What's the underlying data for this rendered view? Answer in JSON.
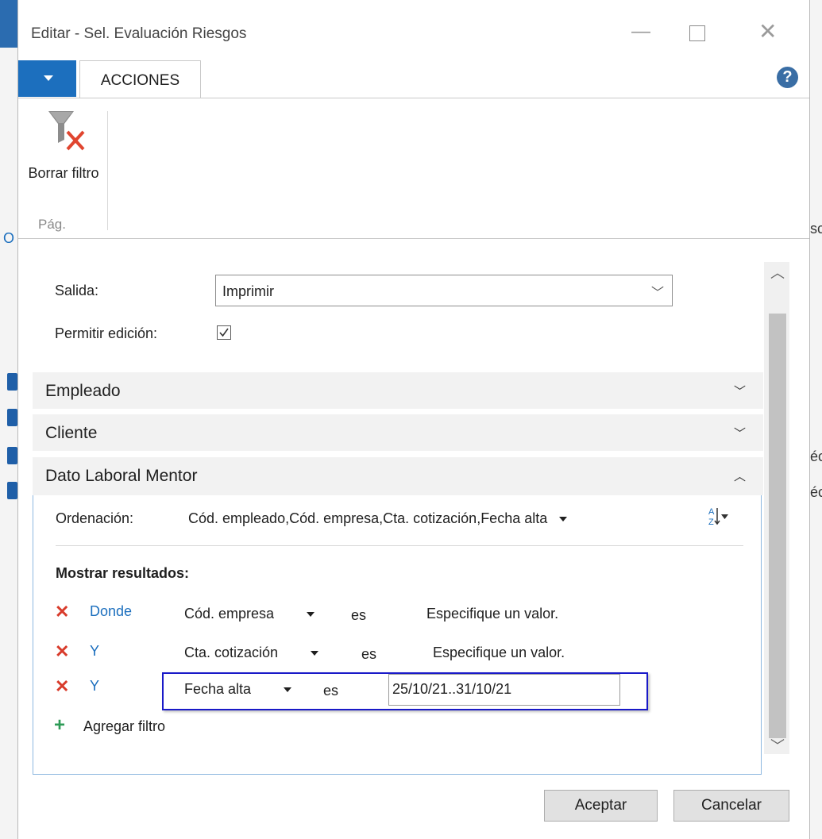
{
  "window": {
    "title": "Editar - Sel. Evaluación Riesgos",
    "minimize_icon": "minimize-icon",
    "maximize_icon": "maximize-icon",
    "close_icon": "close-icon"
  },
  "ribbon": {
    "tab_label": "ACCIONES",
    "help_label": "?",
    "clear_filter_label": "Borrar filtro",
    "group_label": "Pág."
  },
  "options": {
    "salida_label": "Salida:",
    "salida_value": "Imprimir",
    "permitir_label": "Permitir edición:",
    "permitir_checked": true
  },
  "fasttabs": {
    "empleado": "Empleado",
    "cliente": "Cliente",
    "dato": "Dato Laboral Mentor"
  },
  "dato": {
    "ordenacion_label": "Ordenación:",
    "ordenacion_value": "Cód. empleado,Cód. empresa,Cta. cotización,Fecha alta",
    "mostrar_label": "Mostrar resultados:",
    "filters": [
      {
        "connector": "Donde",
        "field": "Cód. empresa",
        "operator": "es",
        "value": "Especifique un valor."
      },
      {
        "connector": "Y",
        "field": "Cta. cotización",
        "operator": "es",
        "value": "Especifique un valor."
      },
      {
        "connector": "Y",
        "field": "Fecha alta",
        "operator": "es",
        "value": "25/10/21..31/10/21"
      }
    ],
    "add_filter_label": "Agregar filtro"
  },
  "footer": {
    "ok_label": "Aceptar",
    "cancel_label": "Cancelar"
  },
  "background": {
    "left_fragment": "O",
    "right_fragments": [
      "sc",
      "éc",
      "éc"
    ]
  },
  "colors": {
    "accent": "#1c6fbe",
    "remove": "#d83b2b",
    "add": "#2e9b57",
    "highlight": "#1919c8"
  }
}
